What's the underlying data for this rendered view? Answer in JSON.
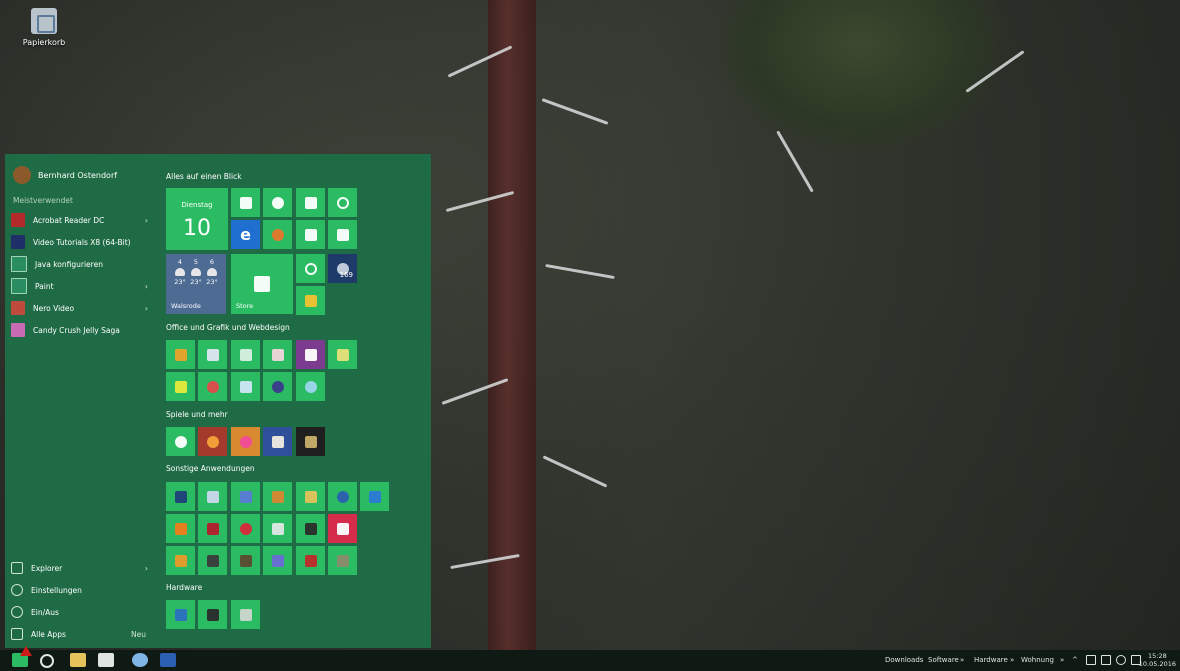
{
  "desktop": {
    "recycle_bin_label": "Papierkorb"
  },
  "start_menu": {
    "user_name": "Bernhard Ostendorf",
    "most_used_title": "Meistverwendet",
    "most_used": [
      {
        "label": "Acrobat Reader DC",
        "has_submenu": true,
        "icon_color": "#b22a2a"
      },
      {
        "label": "Video Tutorials X8 (64-Bit)",
        "has_submenu": false,
        "icon_color": "#1e2e66"
      },
      {
        "label": "Java konfigurieren",
        "has_submenu": false,
        "icon_color": "#2a8c61"
      },
      {
        "label": "Paint",
        "has_submenu": true,
        "icon_color": "#2a8c61"
      },
      {
        "label": "Nero Video",
        "has_submenu": true,
        "icon_color": "#c04a3b"
      },
      {
        "label": "Candy Crush Jelly Saga",
        "has_submenu": false,
        "icon_color": "#c86ab4"
      }
    ],
    "bottom": {
      "explorer": "Explorer",
      "settings": "Einstellungen",
      "power": "Ein/Aus",
      "all_apps": "Alle Apps",
      "new_badge": "Neu"
    },
    "groups": {
      "overview": "Alles auf einen Blick",
      "office": "Office und Grafik und Webdesign",
      "games": "Spiele und mehr",
      "other": "Sonstige Anwendungen",
      "hardware": "Hardware"
    },
    "calendar": {
      "weekday": "Dienstag",
      "day": "10"
    },
    "weather": {
      "days": [
        {
          "day": "4",
          "temp": "23°"
        },
        {
          "day": "5",
          "temp": "23°"
        },
        {
          "day": "6",
          "temp": "23°"
        }
      ],
      "city": "Walsrode"
    },
    "store_label": "Store",
    "badge_count": "169"
  },
  "taskbar": {
    "toolbars": [
      "Downloads",
      "Software",
      "Hardware",
      "Wohnung"
    ],
    "time": "15:28",
    "date": "10.05.2016"
  },
  "colors": {
    "start_bg": "#1f6b45",
    "tile": "#2bbc63",
    "taskbar": "#0f1a14"
  }
}
